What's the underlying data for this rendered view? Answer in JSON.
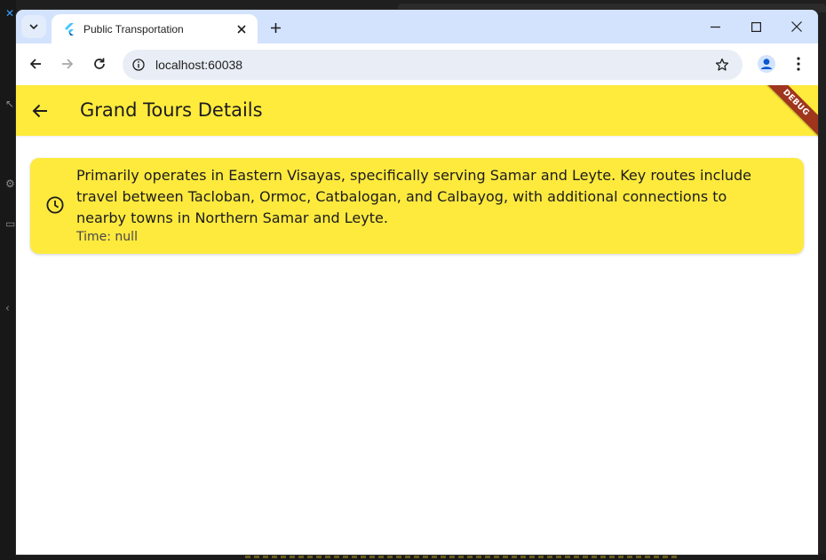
{
  "browser": {
    "tab_title": "Public Transportation",
    "url": "localhost:60038"
  },
  "app": {
    "title": "Grand Tours Details",
    "debug_banner": "DEBUG",
    "colors": {
      "appbar": "#ffeb3b",
      "card": "#fdea3d",
      "debug": "#a0351e"
    },
    "card": {
      "description": "Primarily operates in Eastern Visayas, specifically serving Samar and Leyte. Key routes include travel between Tacloban, Ormoc, Catbalogan, and Calbayog, with additional connections to nearby towns in Northern Samar and Leyte.",
      "time": "Time: null",
      "icon": "clock-icon"
    }
  }
}
